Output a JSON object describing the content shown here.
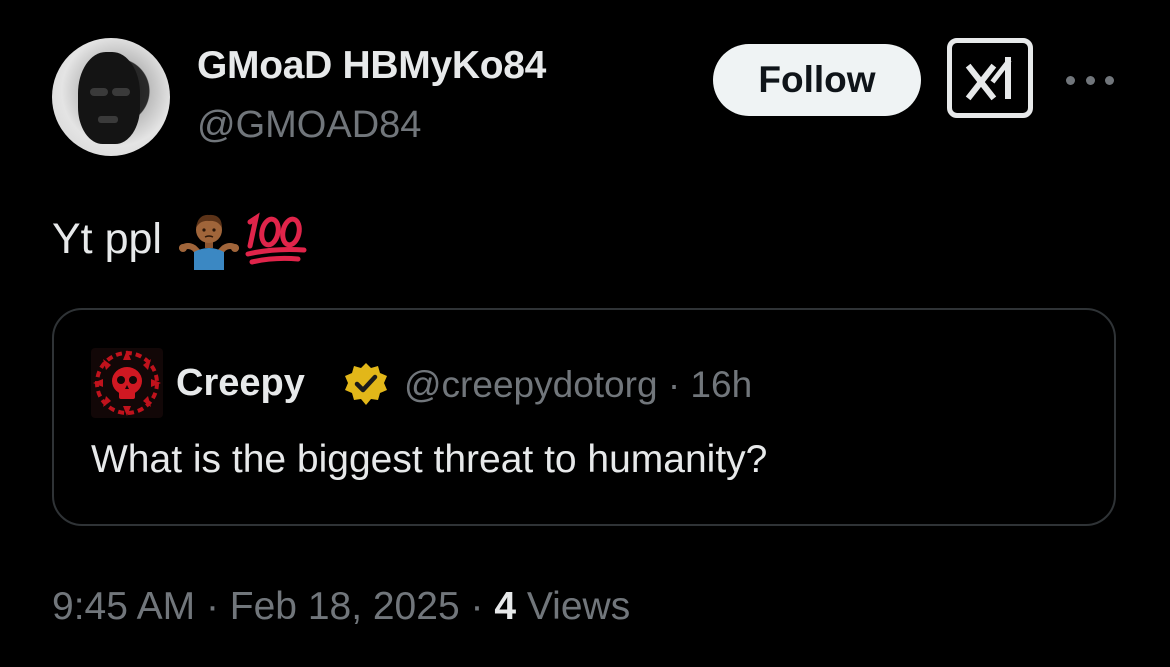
{
  "author": {
    "display_name": "GMoaD HBMyKo84",
    "handle": "@GMOAD84"
  },
  "actions": {
    "follow_label": "Follow",
    "grok_icon": "grok-icon",
    "more_icon": "more-icon"
  },
  "tweet": {
    "text": "Yt ppl",
    "emojis": [
      "shrug-emoji",
      "hundred-points-emoji"
    ]
  },
  "quoted_tweet": {
    "author_name": "Creepy",
    "verified_icon": "verified-badge-icon",
    "handle": "@creepydotorg",
    "separator": "·",
    "age": "16h",
    "text": "What is the biggest threat to humanity?"
  },
  "footer": {
    "time": "9:45 AM",
    "sep1": "·",
    "date": "Feb 18, 2025",
    "sep2": "·",
    "views_count": "4",
    "views_label": "Views"
  },
  "colors": {
    "background": "#000000",
    "primary_text": "#e7e9ea",
    "secondary_text": "#71767b",
    "border": "#2f3336",
    "follow_bg": "#eff3f4",
    "verified_gold": "#e2b719"
  }
}
